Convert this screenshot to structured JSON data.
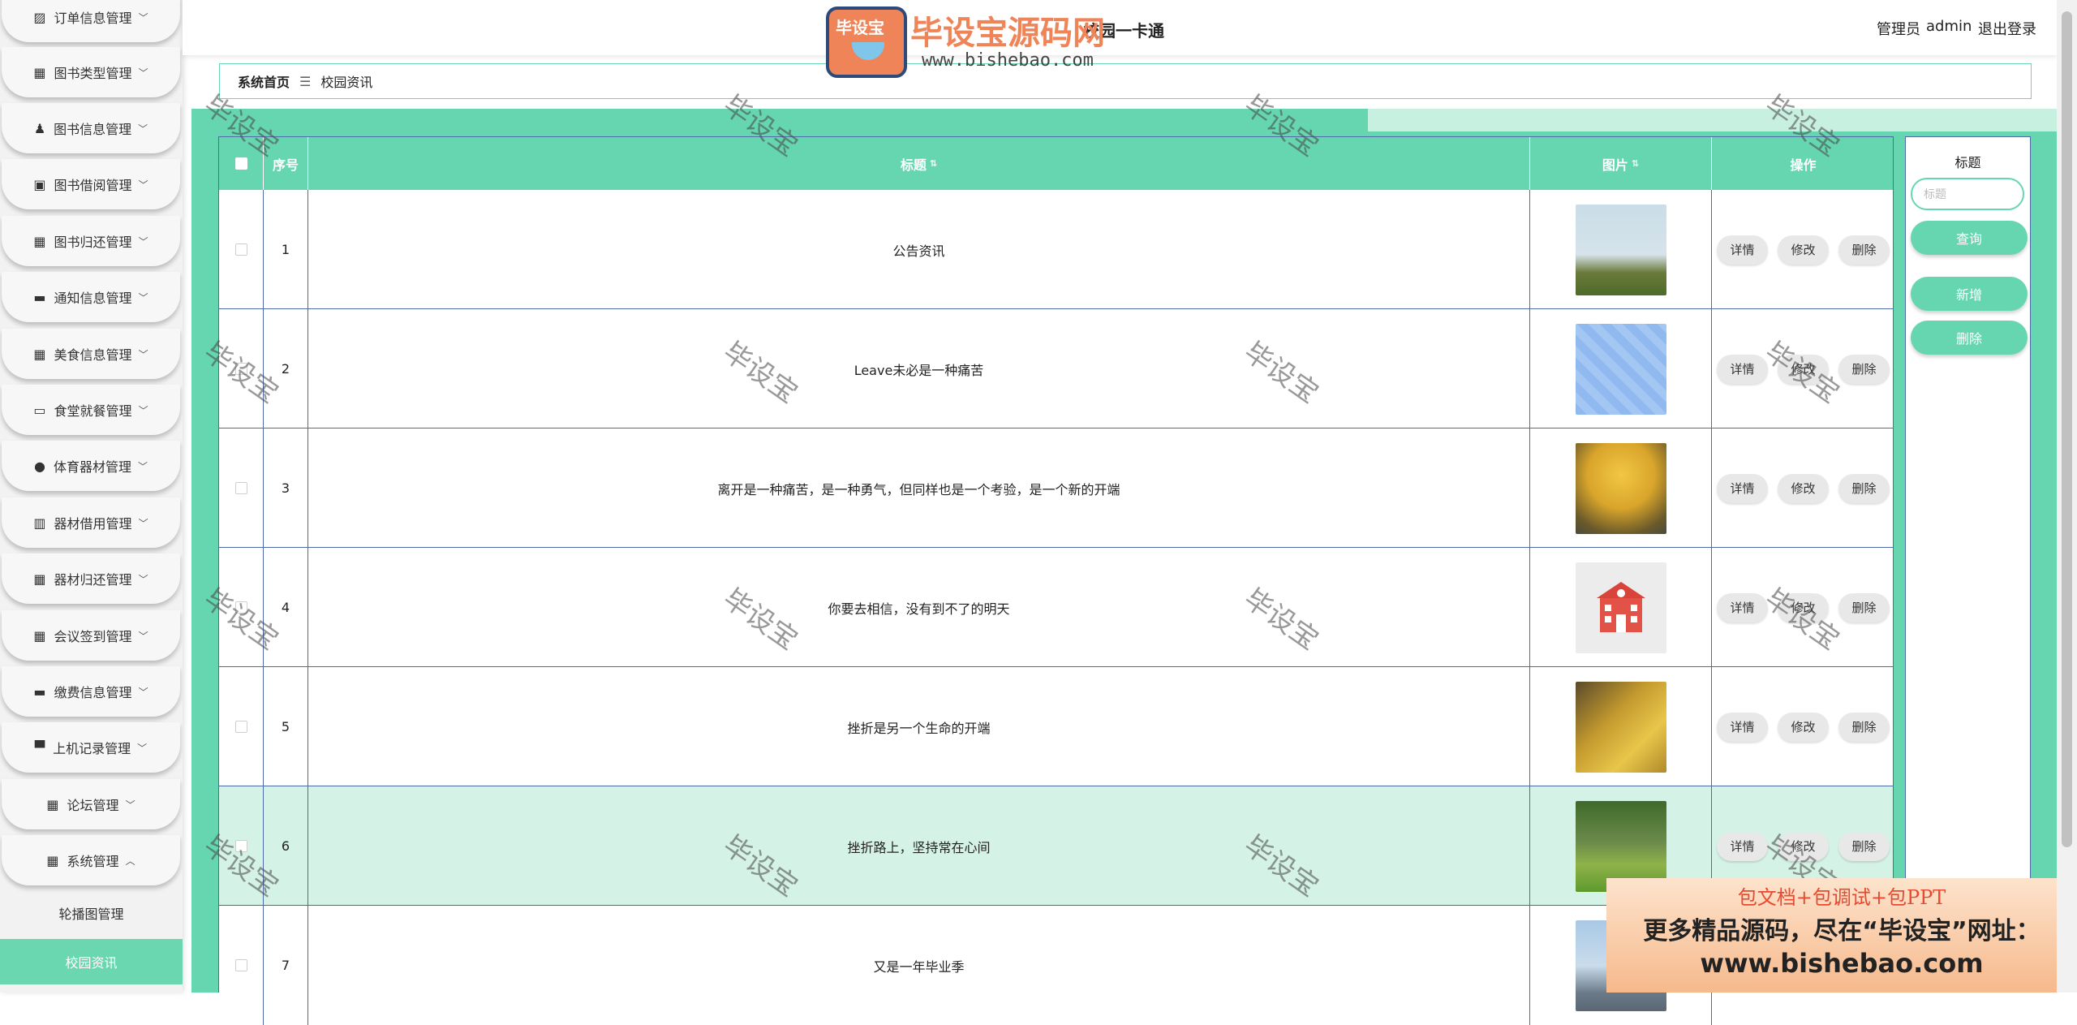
{
  "sidebar": {
    "menus": [
      {
        "label": "订单信息管理",
        "icon": "chart-icon",
        "glyph": "▨"
      },
      {
        "label": "图书类型管理",
        "icon": "grid-icon",
        "glyph": "▦"
      },
      {
        "label": "图书信息管理",
        "icon": "user-icon",
        "glyph": "♟"
      },
      {
        "label": "图书借阅管理",
        "icon": "clipboard-icon",
        "glyph": "▣"
      },
      {
        "label": "图书归还管理",
        "icon": "grid-icon",
        "glyph": "▦"
      },
      {
        "label": "通知信息管理",
        "icon": "chair-icon",
        "glyph": "▬"
      },
      {
        "label": "美食信息管理",
        "icon": "grid-icon",
        "glyph": "▦"
      },
      {
        "label": "食堂就餐管理",
        "icon": "chat-icon",
        "glyph": "▭"
      },
      {
        "label": "体育器材管理",
        "icon": "location-icon",
        "glyph": "●"
      },
      {
        "label": "器材借用管理",
        "icon": "library-icon",
        "glyph": "▥"
      },
      {
        "label": "器材归还管理",
        "icon": "grid-icon",
        "glyph": "▦"
      },
      {
        "label": "会议签到管理",
        "icon": "grid-icon",
        "glyph": "▦"
      },
      {
        "label": "缴费信息管理",
        "icon": "printer-icon",
        "glyph": "▬"
      },
      {
        "label": "上机记录管理",
        "icon": "monitor-icon",
        "glyph": "▀"
      },
      {
        "label": "论坛管理",
        "icon": "apps-icon",
        "glyph": "▦"
      },
      {
        "label": "系统管理",
        "icon": "grid-icon",
        "glyph": "▦",
        "expanded": true
      }
    ],
    "sub_items": [
      {
        "label": "轮播图管理",
        "active": false
      },
      {
        "label": "校园资讯",
        "active": true
      }
    ]
  },
  "header": {
    "title": "校园一卡通",
    "user_role": "管理员",
    "user_name": "admin",
    "logout": "退出登录"
  },
  "watermark": {
    "logo_text": "毕设宝",
    "brand": "毕设宝源码网",
    "url": "www.bishebao.com",
    "stamp": "毕设宝"
  },
  "breadcrumb": {
    "home": "系统首页",
    "sep": "☰",
    "current": "校园资讯"
  },
  "table": {
    "headers": {
      "index": "序号",
      "title": "标题",
      "image": "图片",
      "actions": "操作"
    },
    "actions": {
      "detail": "详情",
      "edit": "修改",
      "delete": "删除"
    },
    "rows": [
      {
        "index": "1",
        "title": "公告资讯"
      },
      {
        "index": "2",
        "title": "Leave未必是一种痛苦"
      },
      {
        "index": "3",
        "title": "离开是一种痛苦，是一种勇气，但同样也是一个考验，是一个新的开端"
      },
      {
        "index": "4",
        "title": "你要去相信，没有到不了的明天"
      },
      {
        "index": "5",
        "title": "挫折是另一个生命的开端"
      },
      {
        "index": "6",
        "title": "挫折路上，坚持常在心间"
      },
      {
        "index": "7",
        "title": "又是一年毕业季"
      }
    ]
  },
  "search": {
    "label": "标题",
    "placeholder": "标题",
    "query_btn": "查询",
    "add_btn": "新增",
    "delete_btn": "删除"
  },
  "promo": {
    "line1": "包文档+包调试+包PPT",
    "line2": "更多精品源码，尽在“毕设宝”网址：",
    "line3": "www.bishebao.com"
  },
  "colors": {
    "accent": "#66d6b1",
    "row_highlight": "#d4f2e5",
    "border": "#4f6aa8"
  }
}
